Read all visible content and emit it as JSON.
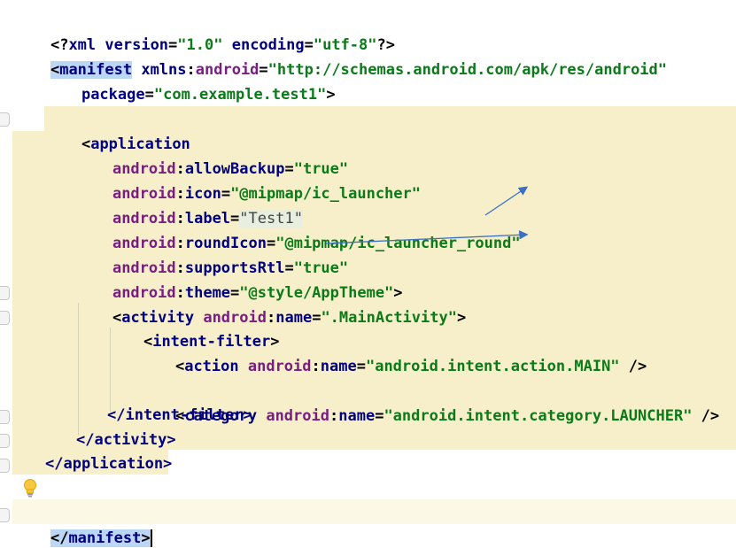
{
  "lines": {
    "xml_decl": {
      "open": "<?",
      "name": "xml",
      "attr1": " version",
      "eq1": "=",
      "val1": "\"1.0\"",
      "attr2": " encoding",
      "eq2": "=",
      "val2": "\"utf-8\"",
      "close": "?>"
    },
    "manifest_open": {
      "lt": "<",
      "tag": "manifest",
      "attr_ns": " xmlns",
      "colon": ":",
      "attr": "android",
      "eq": "=",
      "val": "\"http://schemas.android.com/apk/res/android\""
    },
    "package": {
      "attr": "package",
      "eq": "=",
      "val": "\"com.example.test1\"",
      "gt": ">"
    },
    "application_open": {
      "lt": "<",
      "tag": "application"
    },
    "allow_backup": {
      "ns": "android",
      "colon": ":",
      "attr": "allowBackup",
      "eq": "=",
      "val": "\"true\""
    },
    "icon": {
      "ns": "android",
      "colon": ":",
      "attr": "icon",
      "eq": "=",
      "val": "\"@mipmap/ic_launcher\""
    },
    "label": {
      "ns": "android",
      "colon": ":",
      "attr": "label",
      "eq": "=",
      "val": "\"Test1\""
    },
    "round_icon": {
      "ns": "android",
      "colon": ":",
      "attr": "roundIcon",
      "eq": "=",
      "val": "\"@mipmap/ic_launcher_round\""
    },
    "supports_rtl": {
      "ns": "android",
      "colon": ":",
      "attr": "supportsRtl",
      "eq": "=",
      "val": "\"true\""
    },
    "theme": {
      "ns": "android",
      "colon": ":",
      "attr": "theme",
      "eq": "=",
      "val": "\"@style/AppTheme\"",
      "gt": ">"
    },
    "activity_open": {
      "lt": "<",
      "tag": "activity",
      "ns": " android",
      "colon": ":",
      "attr": "name",
      "eq": "=",
      "val": "\".MainActivity\"",
      "gt": ">"
    },
    "intent_filter_open": {
      "lt": "<",
      "tag": "intent-filter",
      "gt": ">"
    },
    "action": {
      "lt": "<",
      "tag": "action",
      "ns": " android",
      "colon": ":",
      "attr": "name",
      "eq": "=",
      "val": "\"android.intent.action.MAIN\"",
      "close": " />"
    },
    "category": {
      "lt": "<",
      "tag": "category",
      "ns": " android",
      "colon": ":",
      "attr": "name",
      "eq": "=",
      "val": "\"android.intent.category.LAUNCHER\"",
      "close": " />"
    },
    "intent_filter_close": {
      "text": "</intent-filter>"
    },
    "activity_close": {
      "text": "</activity>"
    },
    "application_close": {
      "text": "</application>"
    },
    "manifest_close": {
      "lt": "</",
      "tag": "manifest",
      "gt": ">"
    }
  },
  "icons": {
    "bulb": "lightbulb-icon",
    "arrows": "annotation-arrow"
  },
  "colors": {
    "tag": "#000080",
    "attribute": "#7a1d82",
    "value": "#0b7a19",
    "application_block_bg": "#f6efc9",
    "tag_highlight": "#bcd6f5"
  }
}
